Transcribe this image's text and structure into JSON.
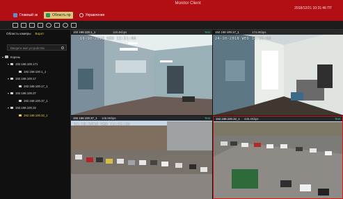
{
  "window": {
    "title": "Monitor Client",
    "datetime": "2018/12/21  10:31:46  ПТ"
  },
  "tabs": [
    {
      "label": "Главный эк",
      "icon": "home-icon"
    },
    {
      "label": "Область пр",
      "icon": "view-icon",
      "active": true
    },
    {
      "label": "Управление",
      "icon": "gear-icon"
    }
  ],
  "sidebar": {
    "tab_all": "Область камеры",
    "tab_fav": "Ворот",
    "search_placeholder": "Введите имя устройства",
    "tree": [
      {
        "label": "Корень",
        "level": 0,
        "type": "folder"
      },
      {
        "label": "192.168.100.171",
        "level": 1,
        "type": "device"
      },
      {
        "label": "192.168.100.1_1",
        "level": 2,
        "type": "channel"
      },
      {
        "label": "192.168.100.17",
        "level": 1,
        "type": "device"
      },
      {
        "label": "192.168.100.17_1",
        "level": 2,
        "type": "channel"
      },
      {
        "label": "192.168.100.37",
        "level": 1,
        "type": "device"
      },
      {
        "label": "192.168.100.37_1",
        "level": 2,
        "type": "channel"
      },
      {
        "label": "192.168.100.32",
        "level": 1,
        "type": "device"
      },
      {
        "label": "192.168.100.32_1",
        "level": 2,
        "type": "channel",
        "selected": true
      }
    ]
  },
  "panels": [
    {
      "caption": "192.168.100.1_1",
      "rate": "119.4Kbps",
      "tag": "Test",
      "osd": "16-10-2018 WED 12:51:08"
    },
    {
      "caption": "192.168.100.17_1",
      "rate": "174.9Kbps",
      "tag": "",
      "osd": "24-10-2018 WED 14:46:00"
    },
    {
      "caption": "192.168.100.37_1",
      "rate": "146.5Kbps",
      "tag": "Test",
      "osd": "24-10-2018 WED 14:45:30"
    },
    {
      "caption": "192.168.100.32_1",
      "rate": "446.4Kbps",
      "tag": "Test",
      "osd": ""
    }
  ]
}
